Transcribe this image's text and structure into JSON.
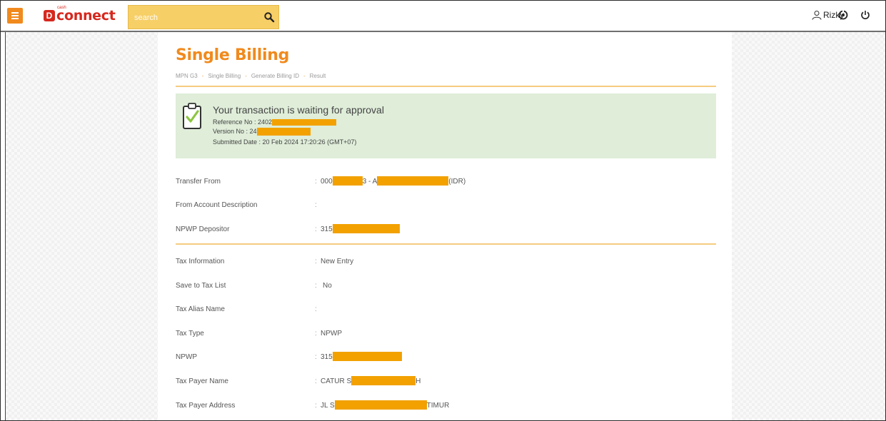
{
  "topbar": {
    "logo_badge": "D",
    "logo_small": "cash",
    "logo_text": "connect",
    "search_placeholder": "search",
    "user_name": "Rizky"
  },
  "page": {
    "title": "Single Billing",
    "breadcrumb": [
      "MPN G3",
      "Single Billing",
      "Generate Billing ID",
      "Result"
    ],
    "breadcrumb_sep": "-"
  },
  "notice": {
    "title": "Your transaction is waiting for approval",
    "reference_label": "Reference No : 2402",
    "version_label": "Version No : 24",
    "submitted_label": "Submitted Date : 20 Feb 2024 17:20:26 (GMT+07)"
  },
  "details": {
    "transfer_from": {
      "label": "Transfer From",
      "prefix": "000",
      "mid": "3 - A",
      "suffix": "(IDR)"
    },
    "from_account_description": {
      "label": "From Account Description",
      "value": ""
    },
    "npwp_depositor": {
      "label": "NPWP Depositor",
      "prefix": "315"
    },
    "tax_information": {
      "label": "Tax Information",
      "value": "New Entry"
    },
    "save_to_tax_list": {
      "label": "Save to Tax List",
      "value": "No"
    },
    "tax_alias_name": {
      "label": "Tax Alias Name",
      "value": ""
    },
    "tax_type": {
      "label": "Tax Type",
      "value": "NPWP"
    },
    "npwp": {
      "label": "NPWP",
      "prefix": "315"
    },
    "tax_payer_name": {
      "label": "Tax Payer Name",
      "prefix": "CATUR S",
      "suffix": "H"
    },
    "tax_payer_address": {
      "label": "Tax Payer Address",
      "prefix": "JL S",
      "suffix": "TIMUR"
    }
  },
  "colors": {
    "accent": "#f08a1d",
    "search_bg": "#f7cf67",
    "notice_bg": "#dfedd9",
    "redaction": "#f2a100",
    "divider": "#f5cd80"
  }
}
